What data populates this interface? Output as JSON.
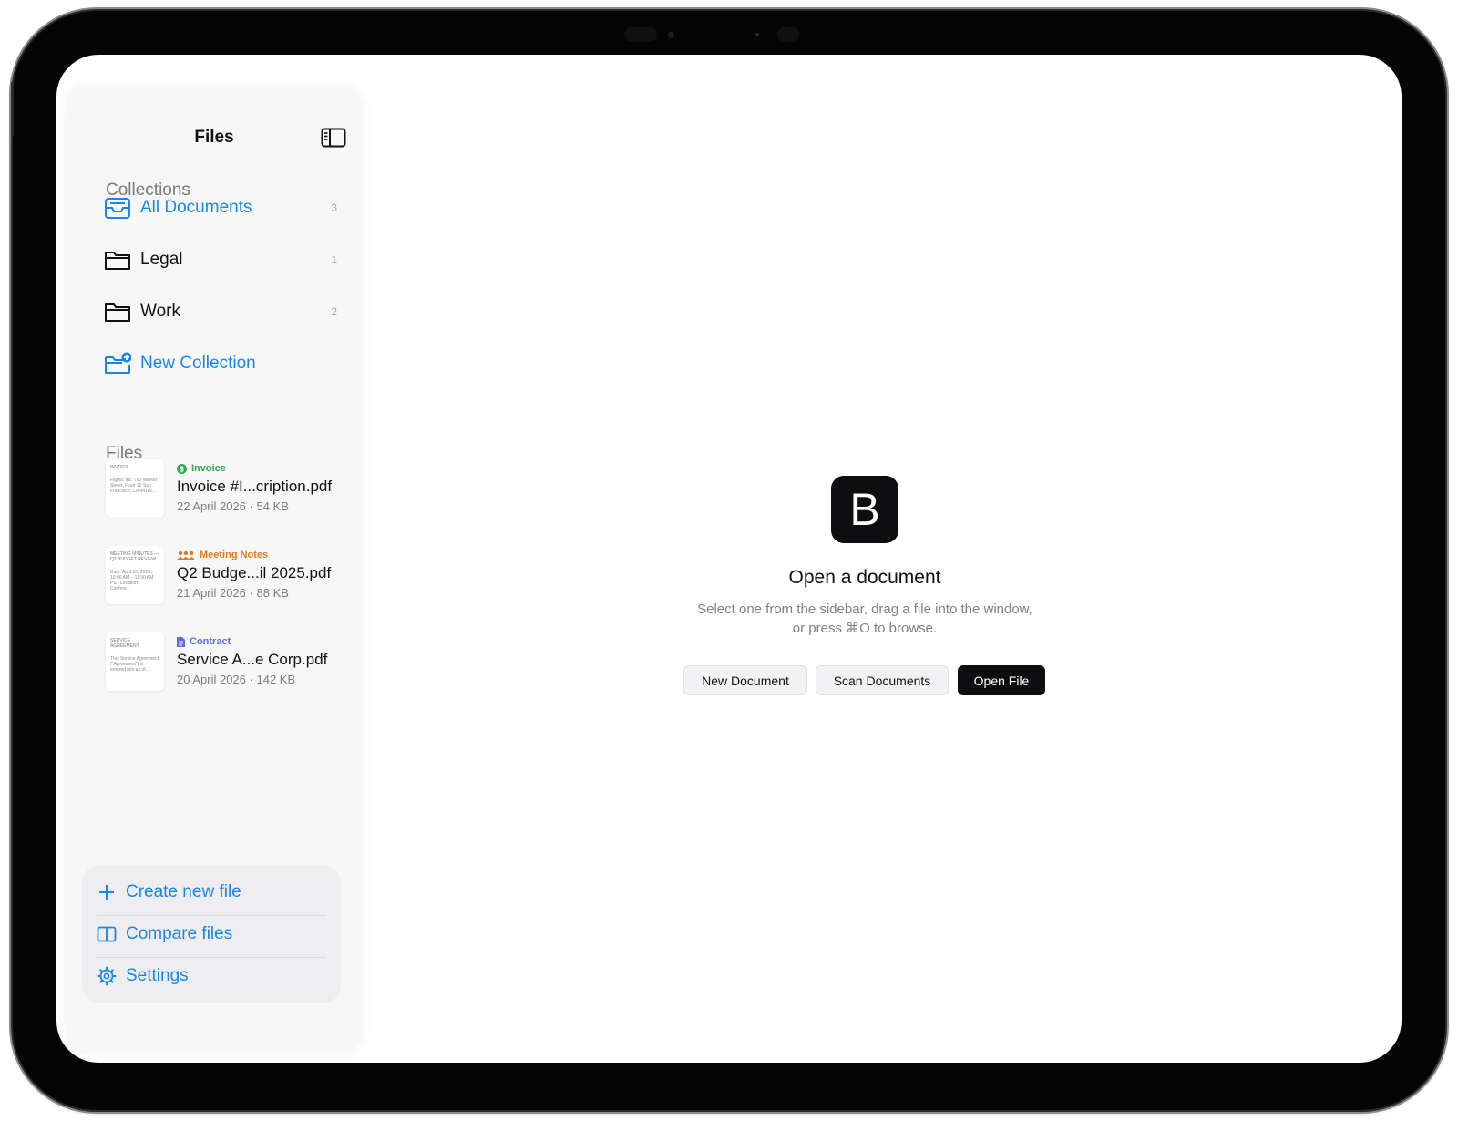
{
  "sidebar": {
    "title": "Files",
    "collections_heading": "Collections",
    "collections": [
      {
        "label": "All Documents",
        "count": "3",
        "icon": "tray-icon",
        "active": true
      },
      {
        "label": "Legal",
        "count": "1",
        "icon": "folder-icon"
      },
      {
        "label": "Work",
        "count": "2",
        "icon": "folder-icon"
      }
    ],
    "new_collection": "New Collection",
    "files_heading": "Files",
    "files": [
      {
        "tag": "Invoice",
        "tag_color": "#2fa84f",
        "tag_icon": "dollar-circle-icon",
        "name": "Invoice #I...cription.pdf",
        "date": "22 April 2026",
        "size": "54 KB",
        "thumb_title": "INVOICE",
        "thumb_text": "Figma, Inc. 760 Market Street, Floor 10 San Francisco, CA 94102..."
      },
      {
        "tag": "Meeting Notes",
        "tag_color": "#e07b20",
        "tag_icon": "people-icon",
        "name": "Q2 Budge...il 2025.pdf",
        "date": "21 April 2026",
        "size": "88 KB",
        "thumb_title": "MEETING MINUTES — Q2 BUDGET REVIEW",
        "thumb_text": "Date: April 15, 2025 | 10:00 AM – 11:30 AM PST Location: Confere..."
      },
      {
        "tag": "Contract",
        "tag_color": "#5b6de0",
        "tag_icon": "document-icon",
        "name": "Service A...e Corp.pdf",
        "date": "20 April 2026",
        "size": "142 KB",
        "thumb_title": "SERVICE AGREEMENT",
        "thumb_text": "This Service Agreement (\"Agreement\") is entered into as of..."
      }
    ],
    "actions": [
      {
        "label": "Create new file",
        "icon": "plus-icon"
      },
      {
        "label": "Compare files",
        "icon": "split-view-icon"
      },
      {
        "label": "Settings",
        "icon": "gear-icon"
      }
    ],
    "meta_separator": "·"
  },
  "main": {
    "logo_letter": "B",
    "title": "Open a document",
    "subtitle_line1": "Select one from the sidebar, drag a file into the window,",
    "subtitle_line2": "or press ⌘O to browse.",
    "buttons": {
      "new_document": "New Document",
      "scan_documents": "Scan Documents",
      "open_file": "Open File"
    }
  },
  "colors": {
    "accent": "#1a86e8",
    "primary_button": "#0e0e10"
  }
}
